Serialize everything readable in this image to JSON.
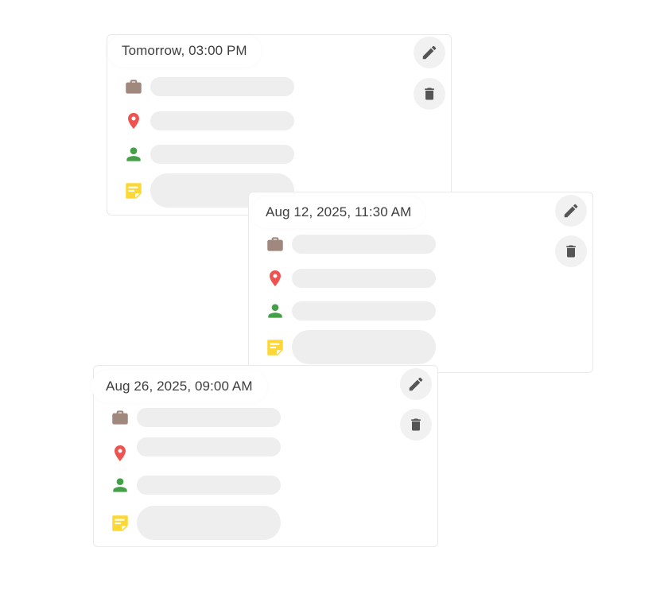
{
  "events": [
    {
      "datetime": "Tomorrow, 03:00 PM"
    },
    {
      "datetime": "Aug 12, 2025, 11:30 AM"
    },
    {
      "datetime": "Aug 26, 2025, 09:00 AM"
    }
  ],
  "icons": {
    "category": "briefcase-icon",
    "location": "location-pin-icon",
    "person": "person-icon",
    "note": "sticky-note-icon",
    "edit": "pencil-icon",
    "delete": "trash-icon"
  },
  "colors": {
    "briefcase": "#a1887f",
    "location": "#ef5350",
    "person": "#43a047",
    "note": "#fdd835",
    "action_icon": "#555555",
    "action_bg": "#f1f1f1",
    "placeholder": "#eeeeee"
  }
}
